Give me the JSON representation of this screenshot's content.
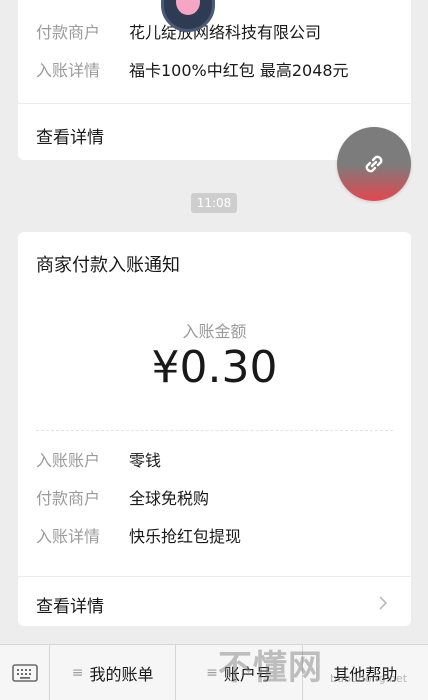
{
  "previous_card": {
    "rows": [
      {
        "label": "付款商户",
        "value": "花儿绽放网络科技有限公司"
      },
      {
        "label": "入账详情",
        "value": "福卡100%中红包  最高2048元"
      }
    ],
    "detail_link": "查看详情"
  },
  "timestamp": "11:08",
  "notice_card": {
    "title": "商家付款入账通知",
    "amount_label": "入账金额",
    "amount_value": "¥0.30",
    "rows": [
      {
        "label": "入账账户",
        "value": "零钱"
      },
      {
        "label": "付款商户",
        "value": "全球免税购"
      },
      {
        "label": "入账详情",
        "value": "快乐抢红包提现"
      }
    ],
    "detail_link": "查看详情"
  },
  "bottom_menu": {
    "items": [
      "我的账单",
      "账户号",
      "其他帮助"
    ]
  },
  "watermark": {
    "main": "不懂网",
    "sub": "bubudong.net"
  },
  "colors": {
    "background": "#ededed",
    "card": "#ffffff",
    "label_gray": "#9b9b9b",
    "float_button_bottom": "#e3474f"
  },
  "icons": {
    "float_button": "link-icon",
    "keyboard": "keyboard-icon",
    "chevron": "chevron-right-icon"
  }
}
